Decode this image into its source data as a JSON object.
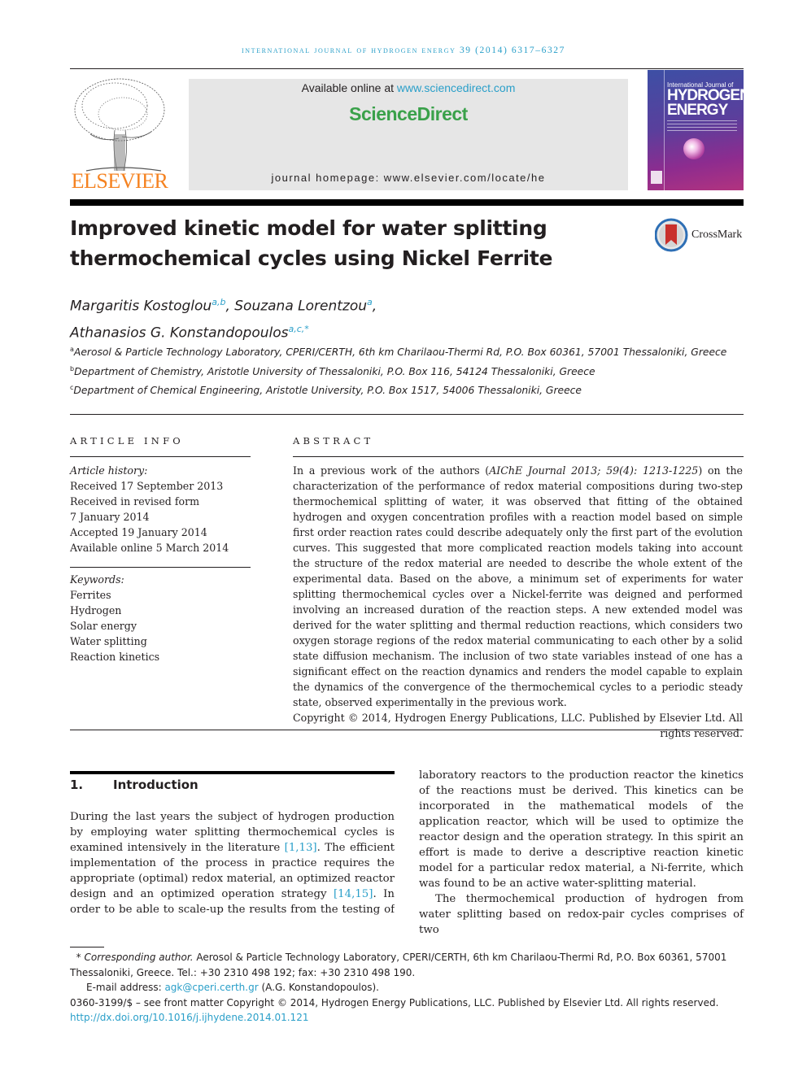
{
  "journal_line": "International Journal of Hydrogen Energy 39 (2014) 6317–6327",
  "header": {
    "publisher": "ELSEVIER",
    "available_prefix": "Available online at ",
    "available_link": "www.sciencedirect.com",
    "brand": "ScienceDirect",
    "homepage": "journal homepage: www.elsevier.com/locate/he",
    "cover": {
      "title_line": "International Journal of",
      "hydrogen": "HYDROGEN",
      "energy": "ENERGY"
    }
  },
  "crossmark": {
    "label": "CrossMark"
  },
  "title": "Improved kinetic model for water splitting thermochemical cycles using Nickel Ferrite",
  "authors": [
    {
      "name": "Margaritis Kostoglou",
      "sup": "a,b",
      "sep": ", "
    },
    {
      "name": "Souzana Lorentzou",
      "sup": "a",
      "sep": ","
    },
    {
      "name": "Athanasios G. Konstandopoulos",
      "sup": "a,c,*",
      "sep": ""
    }
  ],
  "affiliations": [
    {
      "mark": "a",
      "text": "Aerosol & Particle Technology Laboratory, CPERI/CERTH, 6th km Charilaou-Thermi Rd, P.O. Box 60361, 57001 Thessaloniki, Greece"
    },
    {
      "mark": "b",
      "text": "Department of Chemistry, Aristotle University of Thessaloniki, P.O. Box 116, 54124 Thessaloniki, Greece"
    },
    {
      "mark": "c",
      "text": "Department of Chemical Engineering, Aristotle University, P.O. Box 1517, 54006 Thessaloniki, Greece"
    }
  ],
  "article_info": {
    "heading": "ARTICLE INFO",
    "history_label": "Article history:",
    "history": [
      "Received 17 September 2013",
      "Received in revised form",
      "7 January 2014",
      "Accepted 19 January 2014",
      "Available online 5 March 2014"
    ],
    "keywords_label": "Keywords:",
    "keywords": [
      "Ferrites",
      "Hydrogen",
      "Solar energy",
      "Water splitting",
      "Reaction kinetics"
    ]
  },
  "abstract": {
    "heading": "ABSTRACT",
    "lead": "In a previous work of the authors (",
    "citation": "AIChE Journal 2013; 59(4): 1213-1225",
    "body": ") on the characterization of the performance of redox material compositions during two-step thermochemical splitting of water, it was observed that fitting of the obtained hydrogen and oxygen concentration profiles with a reaction model based on simple first order reaction rates could describe adequately only the first part of the evolution curves. This suggested that more complicated reaction models taking into account the structure of the redox material are needed to describe the whole extent of the experimental data. Based on the above, a minimum set of experiments for water splitting thermochemical cycles over a Nickel-ferrite was deigned and performed involving an increased duration of the reaction steps. A new extended model was derived for the water splitting and thermal reduction reactions, which considers two oxygen storage regions of the redox material communicating to each other by a solid state diffusion mechanism. The inclusion of two state variables instead of one has a significant effect on the reaction dynamics and renders the model capable to explain the dynamics of the convergence of the thermochemical cycles to a periodic steady state, observed experimentally in the previous work.",
    "copyright": "Copyright © 2014, Hydrogen Energy Publications, LLC. Published by Elsevier Ltd. All rights reserved."
  },
  "introduction": {
    "number": "1.",
    "heading": "Introduction",
    "p1_a": "During the last years the subject of hydrogen production by employing water splitting thermochemical cycles is examined intensively in the literature ",
    "ref1": "[1,13]",
    "p1_b": ". The efficient implementation of the process in practice requires the appropriate (optimal) redox material, an optimized reactor design and an optimized operation strategy ",
    "ref2": "[14,15]",
    "p1_c": ". In order to be able to scale-up the results from the testing of redox materials in laboratory reactors to the production reactor the kinetics of the reactions must be derived. This kinetics can be incorporated in the mathematical models of the application reactor, which will be used to optimize the reactor design and the operation strategy. In this spirit an effort is made to derive a descriptive reaction kinetic model for a particular redox material, a Ni-ferrite, which was found to be an active water-splitting material.",
    "p2": "The thermochemical production of hydrogen from water splitting based on redox-pair cycles comprises of two"
  },
  "footnotes": {
    "corr_mark": "*",
    "corr_label": "Corresponding author.",
    "corr_text": " Aerosol & Particle Technology Laboratory, CPERI/CERTH, 6th km Charilaou-Thermi Rd, P.O. Box 60361, 57001 Thessaloniki, Greece. Tel.: +30 2310 498 192; fax: +30 2310 498 190.",
    "email_label": "E-mail address: ",
    "email": "agk@cperi.certh.gr",
    "email_suffix": " (A.G. Konstandopoulos).",
    "issn_line": "0360-3199/$ – see front matter Copyright © 2014, Hydrogen Energy Publications, LLC. Published by Elsevier Ltd. All rights reserved.",
    "doi": "http://dx.doi.org/10.1016/j.ijhydene.2014.01.121"
  },
  "colors": {
    "link": "#2a9fc9",
    "elsevier_orange": "#f58220",
    "sciencedirect_green": "#3aa14a",
    "text": "#231f20"
  }
}
